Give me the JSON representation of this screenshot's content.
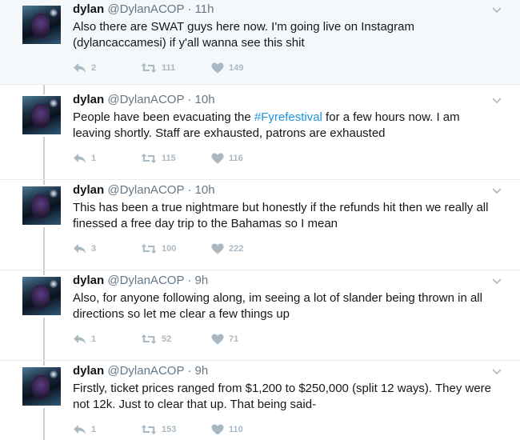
{
  "author": {
    "name": "dylan",
    "handle": "@DylanACOP",
    "separator": "·"
  },
  "icons": {
    "reply": "reply-icon",
    "retweet": "retweet-icon",
    "like": "heart-icon",
    "more": "chevron-down-icon"
  },
  "colors": {
    "hashtag": "#1b95e0",
    "action_gray": "#aab8c2",
    "thread_line": "#c4cfd6",
    "highlight_bg": "#f5f8fa"
  },
  "tweets": [
    {
      "time": "11h",
      "text": "Also there are SWAT guys here now. I'm going live on Instagram (dylancaccamesi) if y'all wanna see this shit",
      "replies": "2",
      "retweets": "111",
      "likes": "149"
    },
    {
      "time": "10h",
      "text_before": "People have been evacuating the ",
      "hashtag": "#Fyrefestival",
      "text_after": " for a few hours now. I am leaving shortly. Staff are exhausted, patrons are exhausted",
      "replies": "1",
      "retweets": "115",
      "likes": "116"
    },
    {
      "time": "10h",
      "text": "This has been a true nightmare but honestly if the refunds hit then we really all finessed a free day trip to the Bahamas so I mean",
      "replies": "3",
      "retweets": "100",
      "likes": "222"
    },
    {
      "time": "9h",
      "text": "Also, for anyone following along, im seeing a lot of slander being thrown in all directions so let me clear a few things up",
      "replies": "1",
      "retweets": "52",
      "likes": "71"
    },
    {
      "time": "9h",
      "text": "Firstly, ticket prices ranged from $1,200 to $250,000 (split 12 ways). They were not 12k. Just to clear that up. That being said-",
      "replies": "1",
      "retweets": "153",
      "likes": "110"
    }
  ]
}
